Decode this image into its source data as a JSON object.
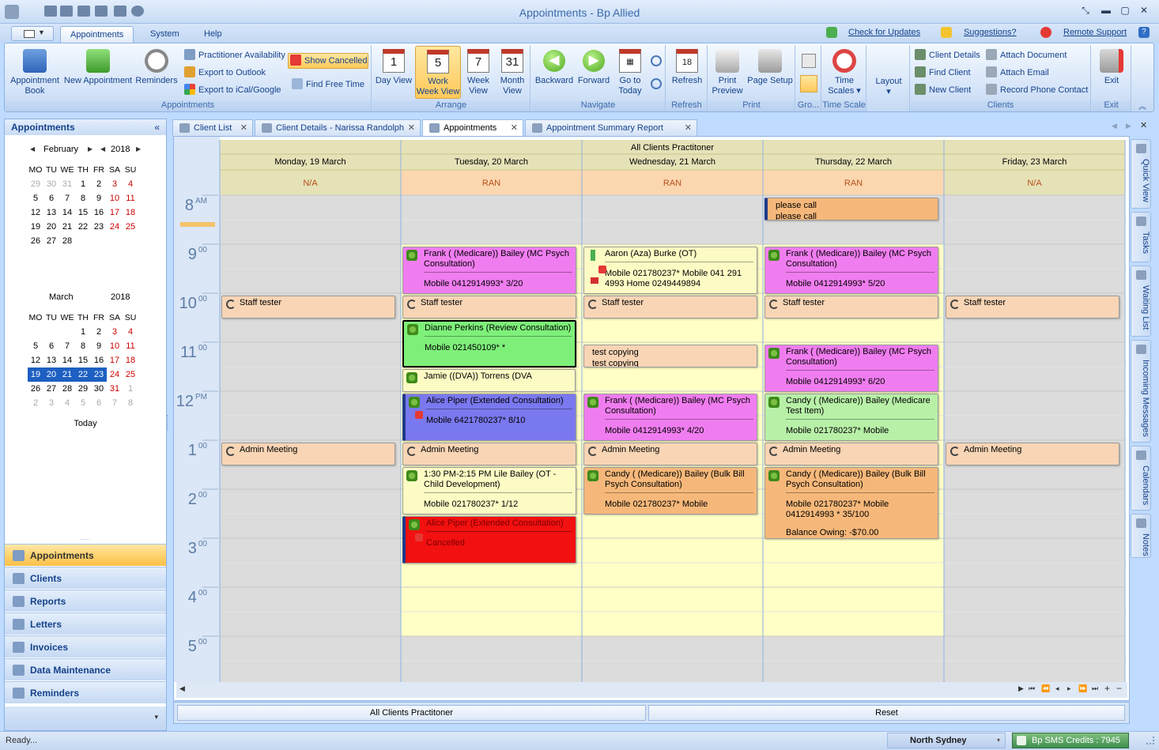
{
  "window": {
    "title": "Appointments - Bp Allied"
  },
  "menu": {
    "tabs": [
      {
        "label": "Appointments"
      },
      {
        "label": "System"
      },
      {
        "label": "Help"
      }
    ],
    "links": {
      "check_updates": "Check for Updates",
      "suggestions": "Suggestions?",
      "remote_support": "Remote Support"
    }
  },
  "ribbon": {
    "appointments": {
      "label": "Appointments",
      "appointment_book": "Appointment Book",
      "new_appointment": "New Appointment",
      "reminders": "Reminders",
      "practitioner_availability": "Practitioner Availability",
      "export_outlook": "Export to Outlook",
      "export_ical": "Export to iCal/Google",
      "show_cancelled": "Show Cancelled",
      "find_free_time": "Find Free Time"
    },
    "arrange": {
      "label": "Arrange",
      "day_view": "Day View",
      "work_week_view": "Work Week View",
      "week_view": "Week View",
      "month_view": "Month View",
      "day_num": "1",
      "work_num": "5",
      "week_num": "7",
      "month_num": "31"
    },
    "navigate": {
      "label": "Navigate",
      "backward": "Backward",
      "forward": "Forward",
      "go_to_today": "Go to Today"
    },
    "refresh": {
      "label": "Refresh",
      "button": "Refresh"
    },
    "print": {
      "label": "Print",
      "print_preview": "Print Preview",
      "page_setup": "Page Setup"
    },
    "group": {
      "label": "Gro..."
    },
    "time_scale": {
      "label": "Time Scale",
      "time_scales": "Time Scales"
    },
    "layout": {
      "button": "Layout"
    },
    "clients": {
      "label": "Clients",
      "client_details": "Client Details",
      "find_client": "Find Client",
      "new_client": "New Client",
      "attach_document": "Attach Document",
      "attach_email": "Attach Email",
      "record_phone_contact": "Record Phone Contact"
    },
    "exit": {
      "label": "Exit",
      "button": "Exit"
    }
  },
  "left_pane": {
    "title": "Appointments",
    "calendar1": {
      "month": "February",
      "year": "2018",
      "weekdays": [
        "MO",
        "TU",
        "WE",
        "TH",
        "FR",
        "SA",
        "SU"
      ],
      "days": [
        "29",
        "30",
        "31",
        "1",
        "2",
        "3",
        "4",
        "5",
        "6",
        "7",
        "8",
        "9",
        "10",
        "11",
        "12",
        "13",
        "14",
        "15",
        "16",
        "17",
        "18",
        "19",
        "20",
        "21",
        "22",
        "23",
        "24",
        "25",
        "26",
        "27",
        "28"
      ]
    },
    "calendar2": {
      "month": "March",
      "year": "2018",
      "weekdays": [
        "MO",
        "TU",
        "WE",
        "TH",
        "FR",
        "SA",
        "SU"
      ],
      "days": [
        "1",
        "2",
        "3",
        "4",
        "5",
        "6",
        "7",
        "8",
        "9",
        "10",
        "11",
        "12",
        "13",
        "14",
        "15",
        "16",
        "17",
        "18",
        "19",
        "20",
        "21",
        "22",
        "23",
        "24",
        "25",
        "26",
        "27",
        "28",
        "29",
        "30",
        "31",
        "1",
        "2",
        "3",
        "4",
        "5",
        "6",
        "7",
        "8"
      ],
      "selected": [
        "19",
        "20",
        "21",
        "22",
        "23"
      ]
    },
    "today": "Today",
    "nav": [
      {
        "label": "Appointments",
        "active": true
      },
      {
        "label": "Clients"
      },
      {
        "label": "Reports"
      },
      {
        "label": "Letters"
      },
      {
        "label": "Invoices"
      },
      {
        "label": "Data Maintenance"
      },
      {
        "label": "Reminders"
      }
    ]
  },
  "doc_tabs": [
    {
      "label": "Client List"
    },
    {
      "label": "Client Details - Narissa Randolph"
    },
    {
      "label": "Appointments",
      "active": true
    },
    {
      "label": "Appointment Summary Report"
    }
  ],
  "schedule": {
    "resource": "All Clients Practitoner",
    "days": [
      {
        "date": "Monday, 19 March",
        "status": "N/A"
      },
      {
        "date": "Tuesday, 20 March",
        "status": "RAN"
      },
      {
        "date": "Wednesday, 21 March",
        "status": "RAN"
      },
      {
        "date": "Thursday, 22 March",
        "status": "RAN"
      },
      {
        "date": "Friday, 23 March",
        "status": "N/A"
      }
    ],
    "hours": [
      {
        "h": "8",
        "m": "AM"
      },
      {
        "h": "9",
        "m": "00"
      },
      {
        "h": "10",
        "m": "00"
      },
      {
        "h": "11",
        "m": "00"
      },
      {
        "h": "12",
        "m": "PM"
      },
      {
        "h": "1",
        "m": "00"
      },
      {
        "h": "2",
        "m": "00"
      },
      {
        "h": "3",
        "m": "00"
      },
      {
        "h": "4",
        "m": "00"
      },
      {
        "h": "5",
        "m": "00"
      }
    ],
    "appointments": {
      "thu_please": {
        "t1": "please call",
        "t2": "please call"
      },
      "tue_frank": {
        "t1": "Frank ( (Medicare)) Bailey (MC Psych Consultation)",
        "t2": "Mobile 0412914993*  3/20"
      },
      "wed_aaron": {
        "t1": "Aaron (Aza) Burke (OT)",
        "t2": "Mobile 021780237* Mobile 041 291 4993 Home 0249449894"
      },
      "thu_frank": {
        "t1": "Frank ( (Medicare)) Bailey (MC Psych Consultation)",
        "t2": "Mobile 0412914993*  5/20"
      },
      "staff": "Staff tester",
      "tue_dianne": {
        "t1": "Dianne Perkins (Review Consultation)",
        "t2": "Mobile 021450109* *"
      },
      "wed_test": {
        "t1": "test copying",
        "t2": "test copying"
      },
      "thu_frank2": {
        "t1": "Frank ( (Medicare)) Bailey (MC Psych Consultation)",
        "t2": "Mobile 0412914993*  6/20"
      },
      "tue_jamie": {
        "t1": "Jamie ((DVA)) Torrens (DVA"
      },
      "tue_alice": {
        "t1": "Alice Piper (Extended Consultation)",
        "t2": "Mobile 6421780237*  8/10"
      },
      "wed_frank": {
        "t1": "Frank ( (Medicare)) Bailey (MC Psych Consultation)",
        "t2": "Mobile 0412914993*  4/20"
      },
      "thu_candy": {
        "t1": "Candy ( (Medicare)) Bailey (Medicare Test Item)",
        "t2": "Mobile 021780237* Mobile"
      },
      "admin": "Admin Meeting",
      "tue_lile": {
        "t1": "1:30 PM-2:15 PM Lile Bailey (OT - Child Development)",
        "t2": "Mobile 021780237*  1/12"
      },
      "wed_candy": {
        "t1": "Candy ( (Medicare)) Bailey (Bulk Bill Psych Consultation)",
        "t2": "Mobile 021780237* Mobile"
      },
      "thu_candy2": {
        "t1": "Candy ( (Medicare)) Bailey (Bulk Bill Psych Consultation)",
        "t2": "Mobile 021780237* Mobile 0412914993 * 35/100",
        "t3": "Balance Owing: -$70.00"
      },
      "tue_alice2": {
        "t1": "Alice Piper (Extended Consultation)",
        "t2": "Cancelled"
      }
    }
  },
  "bottom": {
    "resource_button": "All Clients Practitoner",
    "reset_button": "Reset"
  },
  "side_tabs": [
    "Quick View",
    "Tasks",
    "Waiting List",
    "Incoming Messages",
    "Calendars",
    "Notes"
  ],
  "status": {
    "ready": "Ready...",
    "location": "North Sydney",
    "sms": "Bp SMS Credits : 7945"
  },
  "colors": {
    "pink": "#f07df0",
    "yellow_appt": "#fdfbc4",
    "peach": "#f8d5b5",
    "green": "#7ef07a",
    "blue": "#7a78ee",
    "orange": "#f6b87a",
    "green_light": "#b8f0a8",
    "red": "#f21010",
    "work_yellow": "#ffffc6",
    "off_gray": "#dcdcdc"
  }
}
